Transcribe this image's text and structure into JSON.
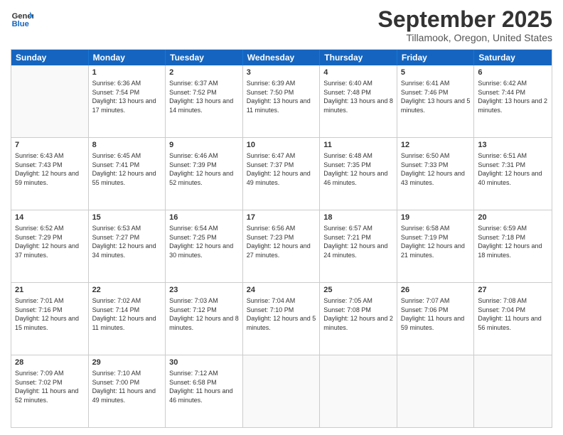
{
  "header": {
    "logo_line1": "General",
    "logo_line2": "Blue",
    "month": "September 2025",
    "location": "Tillamook, Oregon, United States"
  },
  "days_of_week": [
    "Sunday",
    "Monday",
    "Tuesday",
    "Wednesday",
    "Thursday",
    "Friday",
    "Saturday"
  ],
  "weeks": [
    [
      {
        "day": "",
        "empty": true
      },
      {
        "day": "1",
        "sunrise": "Sunrise: 6:36 AM",
        "sunset": "Sunset: 7:54 PM",
        "daylight": "Daylight: 13 hours and 17 minutes."
      },
      {
        "day": "2",
        "sunrise": "Sunrise: 6:37 AM",
        "sunset": "Sunset: 7:52 PM",
        "daylight": "Daylight: 13 hours and 14 minutes."
      },
      {
        "day": "3",
        "sunrise": "Sunrise: 6:39 AM",
        "sunset": "Sunset: 7:50 PM",
        "daylight": "Daylight: 13 hours and 11 minutes."
      },
      {
        "day": "4",
        "sunrise": "Sunrise: 6:40 AM",
        "sunset": "Sunset: 7:48 PM",
        "daylight": "Daylight: 13 hours and 8 minutes."
      },
      {
        "day": "5",
        "sunrise": "Sunrise: 6:41 AM",
        "sunset": "Sunset: 7:46 PM",
        "daylight": "Daylight: 13 hours and 5 minutes."
      },
      {
        "day": "6",
        "sunrise": "Sunrise: 6:42 AM",
        "sunset": "Sunset: 7:44 PM",
        "daylight": "Daylight: 13 hours and 2 minutes."
      }
    ],
    [
      {
        "day": "7",
        "sunrise": "Sunrise: 6:43 AM",
        "sunset": "Sunset: 7:43 PM",
        "daylight": "Daylight: 12 hours and 59 minutes."
      },
      {
        "day": "8",
        "sunrise": "Sunrise: 6:45 AM",
        "sunset": "Sunset: 7:41 PM",
        "daylight": "Daylight: 12 hours and 55 minutes."
      },
      {
        "day": "9",
        "sunrise": "Sunrise: 6:46 AM",
        "sunset": "Sunset: 7:39 PM",
        "daylight": "Daylight: 12 hours and 52 minutes."
      },
      {
        "day": "10",
        "sunrise": "Sunrise: 6:47 AM",
        "sunset": "Sunset: 7:37 PM",
        "daylight": "Daylight: 12 hours and 49 minutes."
      },
      {
        "day": "11",
        "sunrise": "Sunrise: 6:48 AM",
        "sunset": "Sunset: 7:35 PM",
        "daylight": "Daylight: 12 hours and 46 minutes."
      },
      {
        "day": "12",
        "sunrise": "Sunrise: 6:50 AM",
        "sunset": "Sunset: 7:33 PM",
        "daylight": "Daylight: 12 hours and 43 minutes."
      },
      {
        "day": "13",
        "sunrise": "Sunrise: 6:51 AM",
        "sunset": "Sunset: 7:31 PM",
        "daylight": "Daylight: 12 hours and 40 minutes."
      }
    ],
    [
      {
        "day": "14",
        "sunrise": "Sunrise: 6:52 AM",
        "sunset": "Sunset: 7:29 PM",
        "daylight": "Daylight: 12 hours and 37 minutes."
      },
      {
        "day": "15",
        "sunrise": "Sunrise: 6:53 AM",
        "sunset": "Sunset: 7:27 PM",
        "daylight": "Daylight: 12 hours and 34 minutes."
      },
      {
        "day": "16",
        "sunrise": "Sunrise: 6:54 AM",
        "sunset": "Sunset: 7:25 PM",
        "daylight": "Daylight: 12 hours and 30 minutes."
      },
      {
        "day": "17",
        "sunrise": "Sunrise: 6:56 AM",
        "sunset": "Sunset: 7:23 PM",
        "daylight": "Daylight: 12 hours and 27 minutes."
      },
      {
        "day": "18",
        "sunrise": "Sunrise: 6:57 AM",
        "sunset": "Sunset: 7:21 PM",
        "daylight": "Daylight: 12 hours and 24 minutes."
      },
      {
        "day": "19",
        "sunrise": "Sunrise: 6:58 AM",
        "sunset": "Sunset: 7:19 PM",
        "daylight": "Daylight: 12 hours and 21 minutes."
      },
      {
        "day": "20",
        "sunrise": "Sunrise: 6:59 AM",
        "sunset": "Sunset: 7:18 PM",
        "daylight": "Daylight: 12 hours and 18 minutes."
      }
    ],
    [
      {
        "day": "21",
        "sunrise": "Sunrise: 7:01 AM",
        "sunset": "Sunset: 7:16 PM",
        "daylight": "Daylight: 12 hours and 15 minutes."
      },
      {
        "day": "22",
        "sunrise": "Sunrise: 7:02 AM",
        "sunset": "Sunset: 7:14 PM",
        "daylight": "Daylight: 12 hours and 11 minutes."
      },
      {
        "day": "23",
        "sunrise": "Sunrise: 7:03 AM",
        "sunset": "Sunset: 7:12 PM",
        "daylight": "Daylight: 12 hours and 8 minutes."
      },
      {
        "day": "24",
        "sunrise": "Sunrise: 7:04 AM",
        "sunset": "Sunset: 7:10 PM",
        "daylight": "Daylight: 12 hours and 5 minutes."
      },
      {
        "day": "25",
        "sunrise": "Sunrise: 7:05 AM",
        "sunset": "Sunset: 7:08 PM",
        "daylight": "Daylight: 12 hours and 2 minutes."
      },
      {
        "day": "26",
        "sunrise": "Sunrise: 7:07 AM",
        "sunset": "Sunset: 7:06 PM",
        "daylight": "Daylight: 11 hours and 59 minutes."
      },
      {
        "day": "27",
        "sunrise": "Sunrise: 7:08 AM",
        "sunset": "Sunset: 7:04 PM",
        "daylight": "Daylight: 11 hours and 56 minutes."
      }
    ],
    [
      {
        "day": "28",
        "sunrise": "Sunrise: 7:09 AM",
        "sunset": "Sunset: 7:02 PM",
        "daylight": "Daylight: 11 hours and 52 minutes."
      },
      {
        "day": "29",
        "sunrise": "Sunrise: 7:10 AM",
        "sunset": "Sunset: 7:00 PM",
        "daylight": "Daylight: 11 hours and 49 minutes."
      },
      {
        "day": "30",
        "sunrise": "Sunrise: 7:12 AM",
        "sunset": "Sunset: 6:58 PM",
        "daylight": "Daylight: 11 hours and 46 minutes."
      },
      {
        "day": "",
        "empty": true
      },
      {
        "day": "",
        "empty": true
      },
      {
        "day": "",
        "empty": true
      },
      {
        "day": "",
        "empty": true
      }
    ]
  ]
}
